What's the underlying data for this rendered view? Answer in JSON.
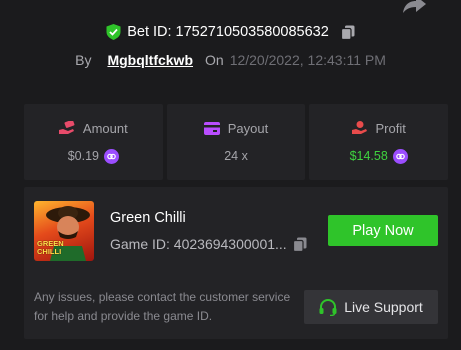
{
  "header": {
    "bet_id_text": "Bet ID: 1752710503580085632",
    "by_label": "By",
    "username": "Mgbqltfckwb",
    "on_label": "On",
    "datetime": "12/20/2022, 12:43:11 PM"
  },
  "stats": [
    {
      "label": "Amount",
      "value": "$0.19",
      "icon": "money-hand-icon",
      "icon_color": "#e84b6a"
    },
    {
      "label": "Payout",
      "value": "24 x",
      "icon": "card-icon",
      "icon_color": "#b94dff"
    },
    {
      "label": "Profit",
      "value": "$14.58",
      "icon": "profit-hand-icon",
      "icon_color": "#e84b4b"
    }
  ],
  "game": {
    "title": "Green Chilli",
    "id_text": "Game ID: 4023694300001...",
    "thumb_text_line1": "GREEN",
    "thumb_text_line2": "CHILLI",
    "play_label": "Play Now",
    "help_text": "Any issues, please contact the customer service for help and provide the game ID.",
    "support_label": "Live Support"
  },
  "colors": {
    "accent_green": "#2fc42a",
    "profit_green": "#3fd33f",
    "coin_purple": "#9b4dff",
    "background": "#1b1b1d",
    "card": "#232326"
  }
}
